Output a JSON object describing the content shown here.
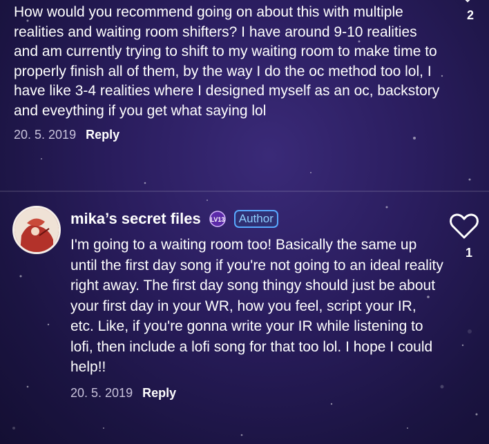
{
  "comments": [
    {
      "text": "How would you recommend going on about this with multiple realities and waiting room shifters? I have around 9-10 realities and am currently trying to shift to my waiting room to make time to properly finish all of them, by the way I do the oc method too lol, I have like 3-4 realities where I designed myself as an oc, backstory and eveything if you get what saying lol",
      "date": "20. 5. 2019",
      "reply_label": "Reply",
      "likes": "2"
    },
    {
      "username": "mika’s secret files",
      "level": "LV13",
      "badge": "Author",
      "text": "I'm going to a waiting room too! Basically the same up until the first day song if you're not going to an ideal reality right away. The first day song thingy should just be about your first day in your WR, how you feel, script your IR, etc. Like, if you're gonna write your IR while listening to lofi, then include a lofi song for that too lol. I hope I could help!!",
      "date": "20. 5. 2019",
      "reply_label": "Reply",
      "likes": "1"
    }
  ],
  "icons": {
    "heart": "heart-icon",
    "chevron": "chevron-down-icon",
    "level": "level-badge-icon"
  },
  "colors": {
    "author_badge": "#58a9ff",
    "background": "#2a1d5e"
  }
}
